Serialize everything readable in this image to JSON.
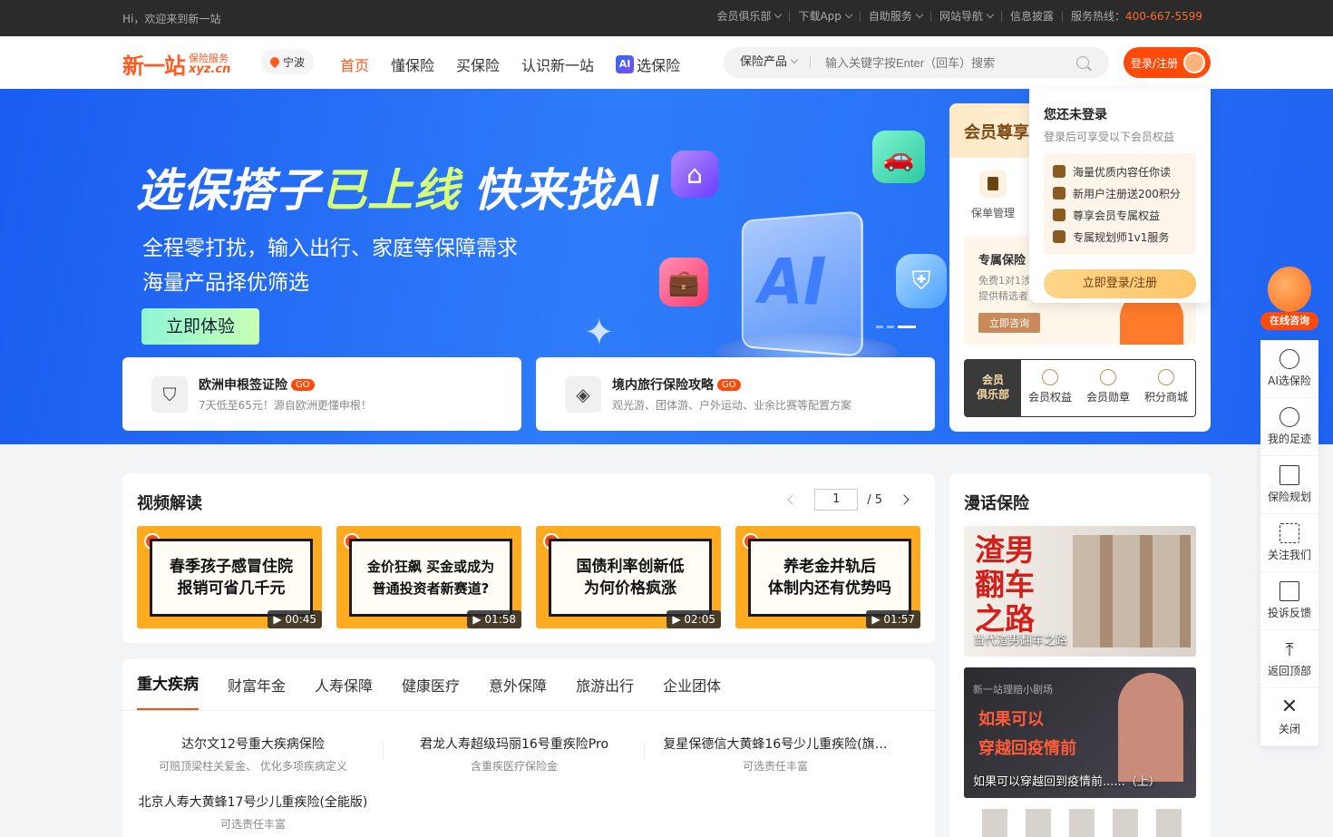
{
  "topbar": {
    "welcome": "Hi，欢迎来到新一站",
    "links": [
      "会员俱乐部",
      "下载App",
      "自助服务",
      "网站导航",
      "信息披露"
    ],
    "hotline_label": "服务热线：",
    "hotline": "400-667-5599"
  },
  "header": {
    "logo_cn": "新一站",
    "logo_sub": "保险服务",
    "logo_domain": "xyz.cn",
    "city": "宁波",
    "nav": [
      "首页",
      "懂保险",
      "买保险",
      "认识新一站",
      "选保险"
    ],
    "nav_ai_badge": "AI",
    "search_category": "保险产品",
    "search_placeholder": "输入关键字按Enter（回车）搜索",
    "login": "登录/注册"
  },
  "banner": {
    "title_a": "选保搭子",
    "title_hl": "已上线",
    "title_b": " 快来找AI",
    "sub1": "全程零打扰，输入出行、家庭等保障需求",
    "sub2": "海量产品择优筛选",
    "cta": "立即体验",
    "cube_text": "AI",
    "promos": [
      {
        "title": "欧洲申根签证险",
        "go": "GO",
        "desc": "7天低至65元！源自欧洲更懂申根！"
      },
      {
        "title": "境内旅行保险攻略",
        "go": "GO",
        "desc": "观光游、团体游、户外运动、业余比赛等配置方案"
      }
    ]
  },
  "member": {
    "title": "会员尊享",
    "grid": [
      "保单管理",
      "",
      ""
    ],
    "exclusive_title": "专属保险",
    "exclusive_desc": "免费1对1涉\n提供精选者",
    "exclusive_btn": "立即咨询",
    "club": "会员\n俱乐部",
    "items": [
      "会员权益",
      "会员勋章",
      "积分商城"
    ]
  },
  "popover": {
    "title": "您还未登录",
    "sub": "登录后可享受以下会员权益",
    "benefits": [
      "海量优质内容任你读",
      "新用户注册送200积分",
      "尊享会员专属权益",
      "专属规划师1v1服务"
    ],
    "btn": "立即登录/注册"
  },
  "video": {
    "title": "视频解读",
    "page": "1",
    "total": "/  5",
    "items": [
      {
        "title": "春季孩子感冒住院\n报销可省几千元",
        "dur": "▶ 00:45"
      },
      {
        "title": "金价狂飙 买金或成为\n普通投资者新赛道?",
        "dur": "▶ 01:58"
      },
      {
        "title": "国债利率创新低\n为何价格疯涨",
        "dur": "▶ 02:05"
      },
      {
        "title": "养老金并轨后\n体制内还有优势吗",
        "dur": "▶ 01:57"
      }
    ]
  },
  "cats": {
    "tabs": [
      "重大疾病",
      "财富年金",
      "人寿保障",
      "健康医疗",
      "意外保障",
      "旅游出行",
      "企业团体"
    ],
    "products": [
      {
        "name": "达尔文12号重大疾病保险",
        "desc": "可赔顶梁柱关爱金、 优化多项疾病定义"
      },
      {
        "name": "君龙人寿超级玛丽16号重疾险Pro",
        "desc": "含重疾医疗保险金"
      },
      {
        "name": "复星保德信大黄蜂16号少儿重疾险(旗…",
        "desc": "可选责任丰富"
      },
      {
        "name": "北京人寿大黄蜂17号少儿重疾险(全能版)",
        "desc": "可选责任丰富"
      }
    ]
  },
  "comic": {
    "title": "漫话保险",
    "items": [
      {
        "caption": "当代渣男翻车之路",
        "art": "渣男\n翻车\n之路"
      },
      {
        "caption": "如果可以穿越回到疫情前......（上）",
        "art_tag": "新一站理赔小剧场",
        "art": "如果可以\n穿越回疫情前"
      }
    ]
  },
  "side": {
    "helper": "在线咨询",
    "items": [
      "AI选保险",
      "我的足迹",
      "保险规划",
      "关注我们",
      "投诉反馈",
      "返回顶部",
      "关闭"
    ]
  },
  "colors": {
    "accent": "#ff4a0a",
    "banner": "#1f63f2",
    "topbar": "#2b2b2b"
  }
}
